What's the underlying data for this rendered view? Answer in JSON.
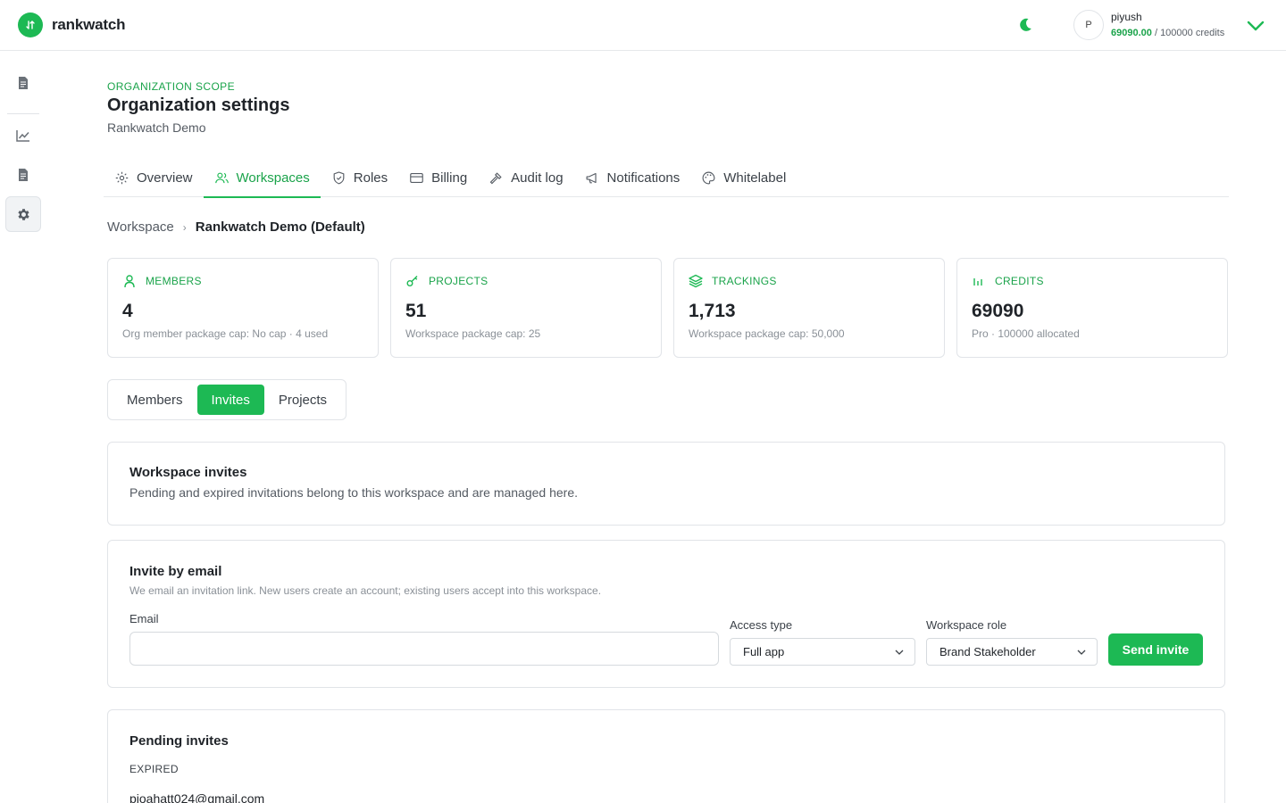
{
  "brand": {
    "name": "rankwatch",
    "accent": "#1db954"
  },
  "user": {
    "initial": "P",
    "name": "piyush",
    "credits_used": "69090.00",
    "credits_total": "/ 100000 credits"
  },
  "sidebar": {
    "items": [
      {
        "icon": "document-icon"
      },
      {
        "icon": "chart-line-icon"
      },
      {
        "icon": "document-icon"
      },
      {
        "icon": "gear-icon",
        "active": true
      }
    ]
  },
  "header": {
    "scope": "ORGANIZATION SCOPE",
    "title": "Organization settings",
    "org": "Rankwatch Demo"
  },
  "tabs": [
    {
      "label": "Overview",
      "icon": "gear-icon"
    },
    {
      "label": "Workspaces",
      "icon": "users-icon",
      "active": true
    },
    {
      "label": "Roles",
      "icon": "shield-icon"
    },
    {
      "label": "Billing",
      "icon": "credit-card-icon"
    },
    {
      "label": "Audit log",
      "icon": "hammer-icon"
    },
    {
      "label": "Notifications",
      "icon": "megaphone-icon"
    },
    {
      "label": "Whitelabel",
      "icon": "palette-icon"
    }
  ],
  "breadcrumb": {
    "root": "Workspace",
    "separator": "›",
    "current": "Rankwatch Demo (Default)"
  },
  "stats": [
    {
      "label": "MEMBERS",
      "icon": "user-icon",
      "value": "4",
      "sub": "Org member package cap: No cap · 4 used"
    },
    {
      "label": "PROJECTS",
      "icon": "key-icon",
      "value": "51",
      "sub": "Workspace package cap: 25"
    },
    {
      "label": "TRACKINGS",
      "icon": "layers-icon",
      "value": "1,713",
      "sub": "Workspace package cap: 50,000"
    },
    {
      "label": "CREDITS",
      "icon": "bars-icon",
      "value": "69090",
      "sub": "Pro · 100000 allocated"
    }
  ],
  "subtabs": [
    {
      "label": "Members"
    },
    {
      "label": "Invites",
      "active": true
    },
    {
      "label": "Projects"
    }
  ],
  "invites_intro": {
    "title": "Workspace invites",
    "desc": "Pending and expired invitations belong to this workspace and are managed here."
  },
  "invite_form": {
    "title": "Invite by email",
    "desc": "We email an invitation link. New users create an account; existing users accept into this workspace.",
    "email_label": "Email",
    "email_value": "",
    "access_label": "Access type",
    "access_value": "Full app",
    "role_label": "Workspace role",
    "role_value": "Brand Stakeholder",
    "send_label": "Send invite"
  },
  "pending": {
    "title": "Pending invites",
    "expired_label": "EXPIRED",
    "first_email": "pjoahatt024@gmail.com"
  }
}
